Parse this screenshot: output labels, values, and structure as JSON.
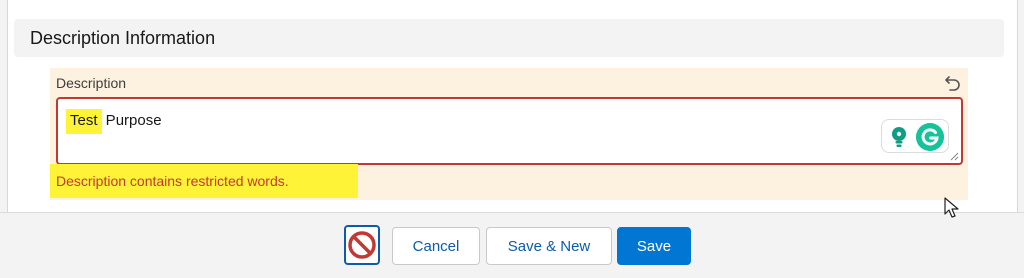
{
  "section": {
    "title": "Description Information"
  },
  "field": {
    "label": "Description",
    "value_highlight": "Test",
    "value_rest": " Purpose",
    "error": "Description contains restricted words."
  },
  "icons": {
    "undo": "undo-icon",
    "grammarly_bulb": "lightbulb-icon",
    "grammarly_logo": "grammarly-g-icon",
    "stop": "prohibited-icon",
    "cursor": "mouse-pointer-icon"
  },
  "colors": {
    "error": "#c23934",
    "highlight": "#fff338",
    "field_bg": "#fdf1e0",
    "brand": "#0176d3"
  },
  "footer": {
    "cancel_label": "Cancel",
    "save_new_label": "Save & New",
    "save_label": "Save"
  }
}
